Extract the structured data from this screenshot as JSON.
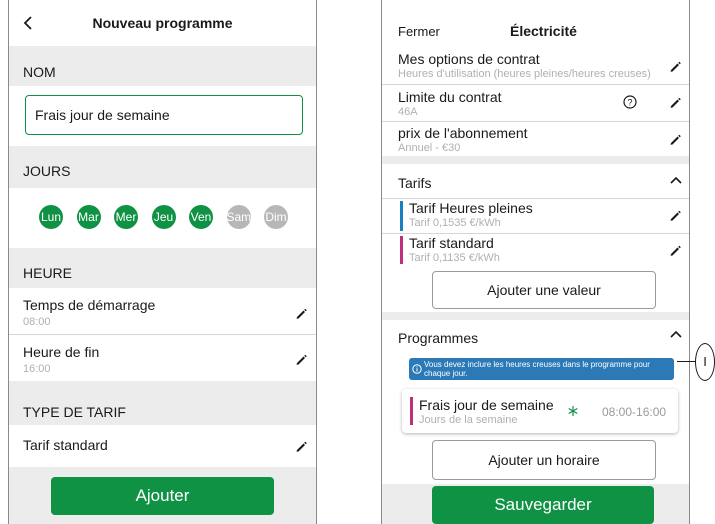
{
  "left": {
    "header_title": "Nouveau programme",
    "sections": {
      "nom": "NOM",
      "jours": "JOURS",
      "heure": "HEURE",
      "type_tarif": "TYPE DE TARIF"
    },
    "name_input_value": "Frais jour de semaine",
    "days": [
      {
        "label": "Lun",
        "active": true
      },
      {
        "label": "Mar",
        "active": true
      },
      {
        "label": "Mer",
        "active": true
      },
      {
        "label": "Jeu",
        "active": true
      },
      {
        "label": "Ven",
        "active": true
      },
      {
        "label": "Sam",
        "active": false
      },
      {
        "label": "Dim",
        "active": false
      }
    ],
    "start_time": {
      "label": "Temps de démarrage",
      "value": "08:00"
    },
    "end_time": {
      "label": "Heure de fin",
      "value": "16:00"
    },
    "tariff": "Tarif standard",
    "add_button": "Ajouter"
  },
  "right": {
    "close_label": "Fermer",
    "header_title": "Électricité",
    "contract_options": {
      "title": "Mes options de contrat",
      "sub": "Heures d'utilisation (heures pleines/heures creuses)"
    },
    "contract_limit": {
      "title": "Limite du contrat",
      "sub": "46A"
    },
    "subscription": {
      "title": "prix de l'abonnement",
      "sub": "Annuel - €30"
    },
    "tariffs_section": "Tarifs",
    "tariffs": [
      {
        "title": "Tarif Heures pleines",
        "sub": "Tarif 0,1535 €/kWh",
        "color": "#1a7fc1"
      },
      {
        "title": "Tarif standard",
        "sub": "Tarif 0,1135 €/kWh",
        "color": "#c0307a"
      }
    ],
    "add_value_button": "Ajouter une valeur",
    "programs_section": "Programmes",
    "info_banner": "Vous devez inclure les heures creuses dans le programme pour chaque jour.",
    "program": {
      "title": "Frais jour de semaine",
      "sub": "Jours de la semaine",
      "time": "08:00-16:00"
    },
    "add_schedule_button": "Ajouter un horaire",
    "save_button": "Sauvegarder",
    "callout": "I"
  },
  "colors": {
    "green": "#109245",
    "info_blue": "#2b79b7",
    "pink": "#c0307a",
    "blue": "#1a7fc1"
  }
}
